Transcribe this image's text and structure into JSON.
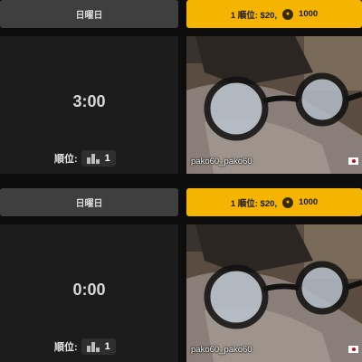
{
  "cards": [
    {
      "day_label": "日曜日",
      "prize": {
        "rank_text": "1 順位: $20,",
        "points": "1000"
      },
      "timer": "3:00",
      "rank_label": "順位:",
      "rank_value": "1",
      "streamer": "pako60_pako60",
      "flag": "japan-flag-icon"
    },
    {
      "day_label": "日曜日",
      "prize": {
        "rank_text": "1 順位: $20,",
        "points": "1000"
      },
      "timer": "0:00",
      "rank_label": "順位:",
      "rank_value": "1",
      "streamer": "pako60_pako60",
      "flag": "japan-flag-icon"
    }
  ],
  "colors": {
    "day_tab_bg": "#3f3f3f",
    "prize_tab_bg": "#f5b400",
    "timer_panel_bg": "#1c1c1c",
    "page_bg": "#0d0d0d"
  }
}
